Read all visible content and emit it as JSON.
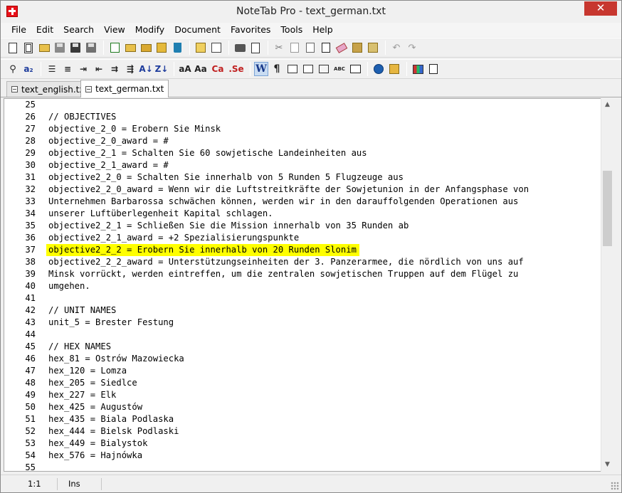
{
  "window": {
    "title": "NoteTab Pro  -  text_german.txt",
    "close_glyph": "✕"
  },
  "menu": [
    "File",
    "Edit",
    "Search",
    "View",
    "Modify",
    "Document",
    "Favorites",
    "Tools",
    "Help"
  ],
  "toolbar1": {
    "icons": [
      "new-doc-icon",
      "new-outline-icon",
      "open-folder-icon",
      "save-icon",
      "save-all-icon",
      "save-copy-icon",
      "reload-icon",
      "open-favorites-icon",
      "open-files-icon",
      "fav-edit-icon",
      "delete-icon",
      "clip-new-icon",
      "clip-open-icon",
      "print-icon",
      "print-preview-icon",
      "cut-icon",
      "copy-icon",
      "paste-icon",
      "paste-special-icon",
      "erase-icon",
      "clipboard-icon",
      "clipboard-paste-icon",
      "undo-icon",
      "redo-icon"
    ]
  },
  "toolbar2": {
    "glyphs": {
      "find_glyph": "🔍",
      "sort_asc": "A↓",
      "sort_desc": "Z↓",
      "case_small": "aA",
      "case_big": "Aa",
      "case_ca": "Ca",
      "case_se": ".Se",
      "wordwrap": "W",
      "pilcrow": "¶",
      "spell": "ABC"
    }
  },
  "tabs": [
    {
      "label": "text_english.txt",
      "active": false
    },
    {
      "label": "text_german.txt",
      "active": true
    }
  ],
  "editor": {
    "highlight_color": "#ffff00",
    "lines": [
      {
        "num": "25",
        "text": ""
      },
      {
        "num": "26",
        "text": "// OBJECTIVES"
      },
      {
        "num": "27",
        "text": "objective_2_0 = Erobern Sie Minsk"
      },
      {
        "num": "28",
        "text": "objective_2_0_award = #"
      },
      {
        "num": "29",
        "text": "objective_2_1 = Schalten Sie 60 sowjetische Landeinheiten aus"
      },
      {
        "num": "30",
        "text": "objective_2_1_award = #"
      },
      {
        "num": "31",
        "text": "objective2_2_0 = Schalten Sie innerhalb von 5 Runden 5 Flugzeuge aus"
      },
      {
        "num": "32",
        "text": "objective2_2_0_award = Wenn wir die Luftstreitkräfte der Sowjetunion in der Anfangsphase von"
      },
      {
        "num": "33",
        "text": "Unternehmen Barbarossa schwächen können, werden wir in den darauffolgenden Operationen aus"
      },
      {
        "num": "34",
        "text": "unserer Luftüberlegenheit Kapital schlagen."
      },
      {
        "num": "35",
        "text": "objective2_2_1 = Schließen Sie die Mission innerhalb von 35 Runden ab"
      },
      {
        "num": "36",
        "text": "objective2_2_1_award = +2 Spezialisierungspunkte"
      },
      {
        "num": "37",
        "text": "objective2_2_2 = Erobern Sie innerhalb von 20 Runden Slonim",
        "highlight": true
      },
      {
        "num": "38",
        "text": "objective2_2_2_award = Unterstützungseinheiten der 3. Panzerarmee, die nördlich von uns auf"
      },
      {
        "num": "39",
        "text": "Minsk vorrückt, werden eintreffen, um die zentralen sowjetischen Truppen auf dem Flügel zu"
      },
      {
        "num": "40",
        "text": "umgehen."
      },
      {
        "num": "41",
        "text": ""
      },
      {
        "num": "42",
        "text": "// UNIT NAMES"
      },
      {
        "num": "43",
        "text": "unit_5 = Brester Festung"
      },
      {
        "num": "44",
        "text": ""
      },
      {
        "num": "45",
        "text": "// HEX NAMES"
      },
      {
        "num": "46",
        "text": "hex_81 = Ostrów Mazowiecka"
      },
      {
        "num": "47",
        "text": "hex_120 = Lomza"
      },
      {
        "num": "48",
        "text": "hex_205 = Siedlce"
      },
      {
        "num": "49",
        "text": "hex_227 = Elk"
      },
      {
        "num": "50",
        "text": "hex_425 = Augustów"
      },
      {
        "num": "51",
        "text": "hex_435 = Biala Podlaska"
      },
      {
        "num": "52",
        "text": "hex_444 = Bielsk Podlaski"
      },
      {
        "num": "53",
        "text": "hex_449 = Bialystok"
      },
      {
        "num": "54",
        "text": "hex_576 = Hajnówka"
      },
      {
        "num": "55",
        "text": ""
      }
    ]
  },
  "scrollbar": {
    "up_glyph": "▲",
    "down_glyph": "▼"
  },
  "status": {
    "position": "1:1",
    "mode": "Ins"
  }
}
